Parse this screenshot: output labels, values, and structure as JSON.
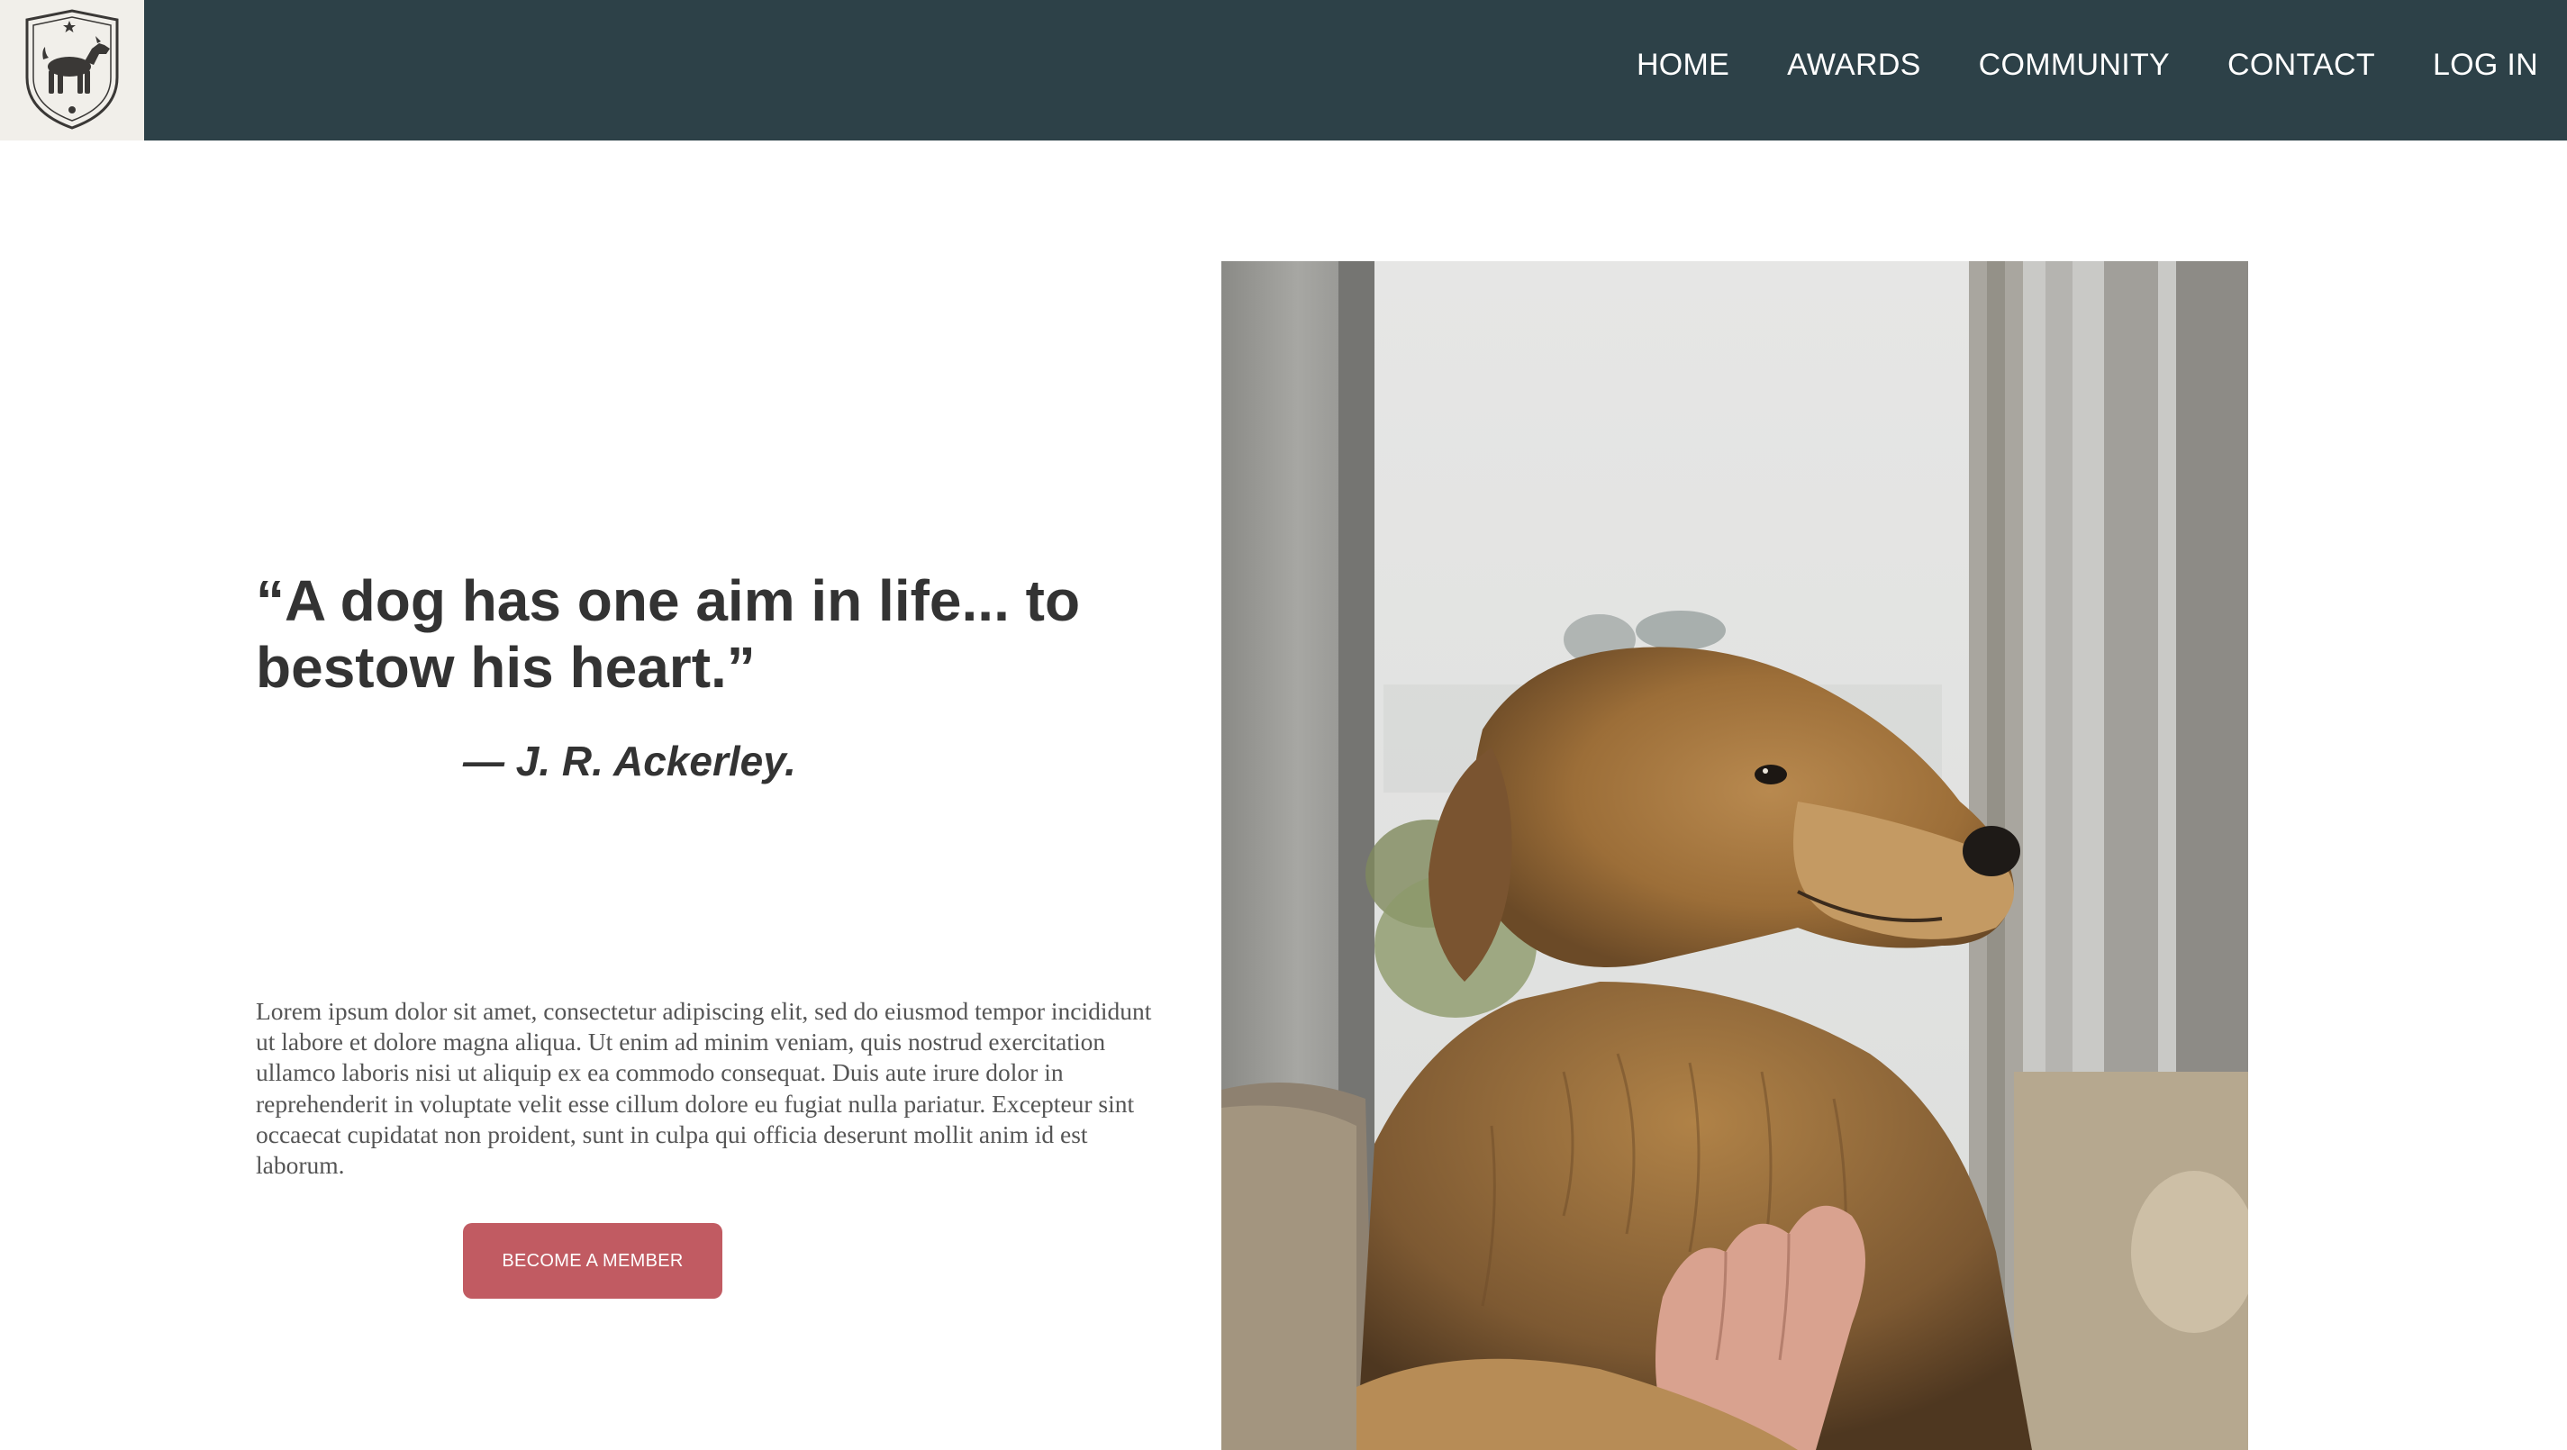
{
  "nav": {
    "logo": "dog-crest-logo",
    "links": [
      "HOME",
      "AWARDS",
      "COMMUNITY",
      "CONTACT",
      "LOG IN"
    ]
  },
  "hero": {
    "quote": "“A dog has one aim in life... to bestow his heart.”",
    "author": "— J. R. Ackerley.",
    "body": "Lorem ipsum dolor sit amet, consectetur adipiscing elit, sed do eiusmod tempor incididunt ut labore et dolore magna aliqua. Ut enim ad minim veniam, quis nostrud exercitation ullamco laboris nisi ut aliquip ex ea commodo consequat. Duis aute irure dolor in reprehenderit in voluptate velit esse cillum dolore eu fugiat nulla pariatur. Excepteur sint occaecat cupidatat non proident, sunt in culpa qui officia deserunt mollit anim id est laborum.",
    "cta_label": "BECOME A MEMBER",
    "image": "golden-retriever-photo"
  },
  "colors": {
    "navbar": "#2d4148",
    "logo_background": "#f1efea",
    "cta": "#c15b62",
    "heading_text": "#333333",
    "body_text": "#555555"
  }
}
